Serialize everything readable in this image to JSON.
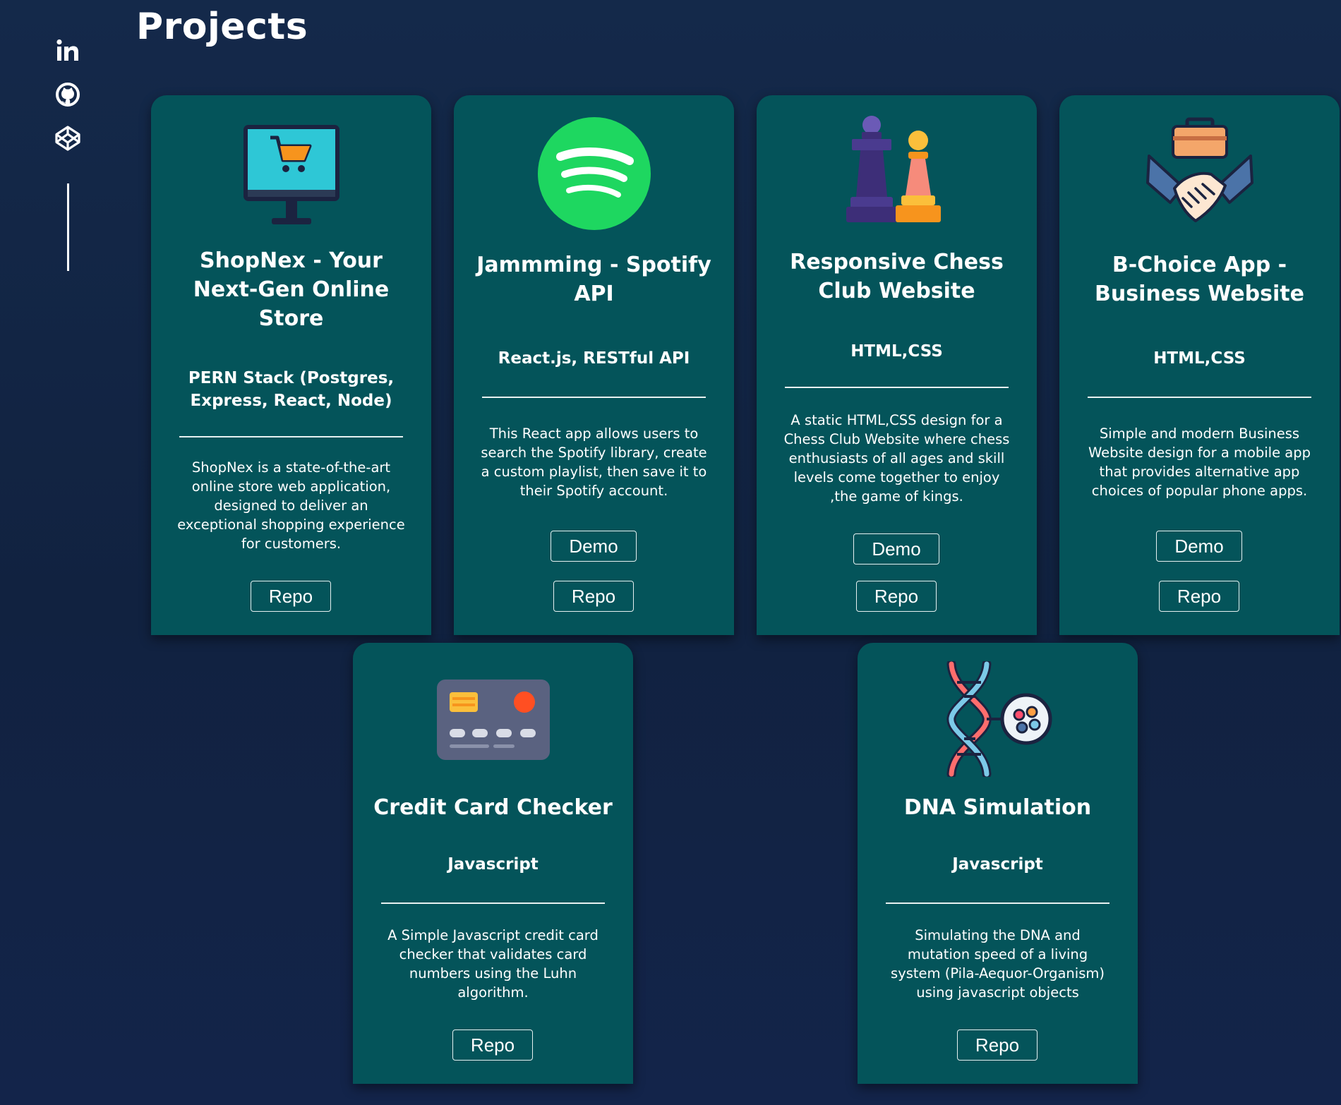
{
  "page": {
    "title": "Projects"
  },
  "social": [
    {
      "name": "LinkedIn",
      "icon": "linkedin-icon"
    },
    {
      "name": "GitHub",
      "icon": "github-icon"
    },
    {
      "name": "CodePen",
      "icon": "codepen-icon"
    }
  ],
  "projects": [
    {
      "title": "ShopNex - Your Next-Gen Online Store",
      "tech": "PERN Stack (Postgres, Express, React, Node)",
      "description": "ShopNex is a state-of-the-art online store web application, designed to deliver an exceptional shopping experience for customers.",
      "icon": "computer-shopping-cart-icon",
      "repo_label": "Repo"
    },
    {
      "title": "Jammming - Spotify API",
      "tech": "React.js, RESTful API",
      "description": "This React app allows users to search the Spotify library, create a custom playlist, then save it to their Spotify account.",
      "icon": "spotify-icon",
      "demo_label": "Demo",
      "repo_label": "Repo"
    },
    {
      "title": "Responsive Chess Club Website",
      "tech": "HTML,CSS",
      "description": "A static HTML,CSS design for a Chess Club Website where chess enthusiasts of all ages and skill levels come together to enjoy ,the game of kings.",
      "icon": "chess-pieces-icon",
      "demo_label": "Demo",
      "repo_label": "Repo"
    },
    {
      "title": "B-Choice App - Business Website",
      "tech": "HTML,CSS",
      "description": "Simple and modern Business Website design for a mobile app that provides alternative app choices of popular phone apps.",
      "icon": "handshake-briefcase-icon",
      "demo_label": "Demo",
      "repo_label": "Repo"
    },
    {
      "title": "Credit Card Checker",
      "tech": "Javascript",
      "description": "A Simple Javascript credit card checker that validates card numbers using the Luhn algorithm.",
      "icon": "credit-card-icon",
      "repo_label": "Repo"
    },
    {
      "title": "DNA Simulation",
      "tech": "Javascript",
      "description": "Simulating the DNA and mutation speed of a living system (Pila-Aequor-Organism) using javascript objects",
      "icon": "dna-molecule-icon",
      "repo_label": "Repo"
    }
  ],
  "colors": {
    "background": "#112240",
    "card": "#04545a",
    "text": "#ffffff",
    "spotify_green": "#1ed760"
  }
}
